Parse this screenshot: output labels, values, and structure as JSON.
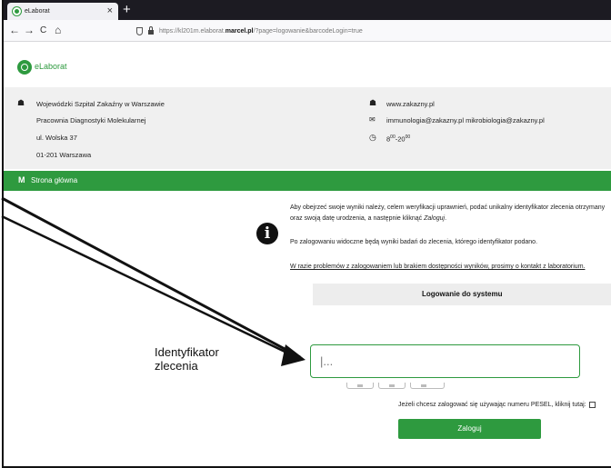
{
  "browser": {
    "tab_title": "eLaborat",
    "tab_close": "×",
    "new_tab": "+",
    "nav_back": "←",
    "nav_forward": "→",
    "nav_reload": "C",
    "nav_home": "⌂",
    "url_prefix": "https://kl201m.elaborat.",
    "url_domain": "marcel.pl",
    "url_rest": "/?page=logowanie&barcodeLogin=true"
  },
  "header": {
    "logo_text": "eLaborat"
  },
  "info": {
    "hospital_name": "Wojewódzki Szpital Zakaźny w Warszawie",
    "department": "Pracownia Diagnostyki Molekularnej",
    "street": "ul. Wolska 37",
    "postal": "01-201 Warszawa",
    "website": "www.zakazny.pl",
    "emails": "immunologia@zakazny.pl mikrobiologia@zakazny.pl",
    "hours_from": "8",
    "hours_from_sup": "00",
    "hours_sep": "-20",
    "hours_to_sup": "00"
  },
  "nav": {
    "home_label": "Strona główna",
    "home_icon": "M"
  },
  "notice": {
    "icon": "i",
    "line1": "Aby obejrzeć swoje wyniki należy, celem weryfikacji uprawnień, podać unikalny identyfikator zlecenia otrzymany",
    "line2_a": "oraz swoją datę urodzenia, a następnie kliknąć ",
    "line2_b": "Zaloguj",
    "line2_c": ".",
    "line3": "Po zalogowaniu widoczne będą wyniki badań do zlecenia, którego identyfikator podano.",
    "line4": "W razie problemów z zalogowaniem lub brakiem dostępności wyników, prosimy o kontakt z laboratorium."
  },
  "login": {
    "title": "Logowanie do systemu",
    "id_label": "Identyfikator zlecenia",
    "id_placeholder": "|...",
    "pesel_text": "Jeżeli chcesz zalogować się używając numeru PESEL, kliknij tutaj:",
    "submit_label": "Zaloguj"
  },
  "colors": {
    "brand_green": "#2e9a3f",
    "tabbar_dark": "#1c1b22"
  }
}
